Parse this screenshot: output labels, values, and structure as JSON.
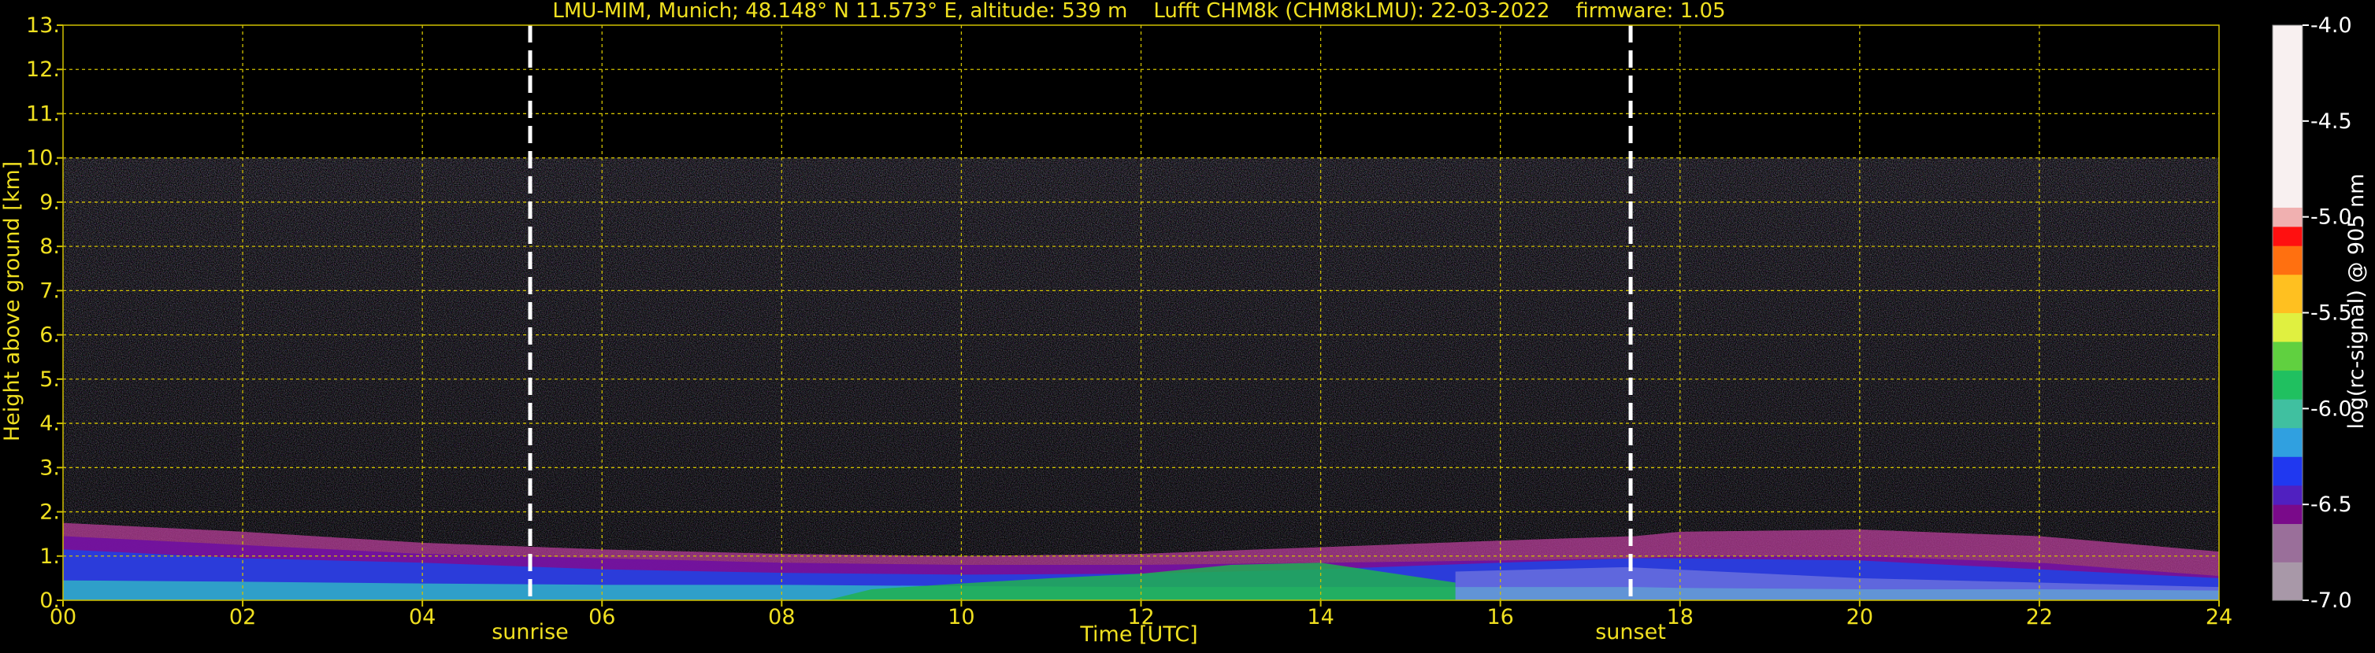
{
  "chart_data": {
    "type": "heatmap",
    "title": "LMU-MIM, Munich; 48.148° N 11.573° E, altitude: 539 m    Lufft CHM8k (CHM8kLMU): 22-03-2022    firmware: 1.05",
    "xlabel": "Time [UTC]",
    "ylabel": "Height above ground [km]",
    "xlim": [
      0,
      24
    ],
    "ylim": [
      0,
      13
    ],
    "x_ticks": [
      "00",
      "02",
      "04",
      "06",
      "08",
      "10",
      "12",
      "14",
      "16",
      "18",
      "20",
      "22",
      "24"
    ],
    "y_ticks": [
      "0.",
      "1.",
      "2.",
      "3.",
      "4.",
      "5.",
      "6.",
      "7.",
      "8.",
      "9.",
      "10.",
      "11.",
      "12.",
      "13."
    ],
    "grid": true,
    "data_max_height_km": 10,
    "markers": [
      {
        "label": "sunrise",
        "time_h": 5.2
      },
      {
        "label": "sunset",
        "time_h": 17.45
      }
    ],
    "layers": [
      {
        "name": "noise",
        "top_km": 10,
        "description_color": "speckle"
      },
      {
        "name": "pink-aerosol-top",
        "points": [
          [
            0,
            1.75
          ],
          [
            2,
            1.55
          ],
          [
            4,
            1.3
          ],
          [
            6,
            1.15
          ],
          [
            8,
            1.05
          ],
          [
            10,
            1.0
          ],
          [
            12,
            1.05
          ],
          [
            14,
            1.2
          ],
          [
            16,
            1.35
          ],
          [
            17.5,
            1.45
          ],
          [
            18,
            1.55
          ],
          [
            20,
            1.6
          ],
          [
            22,
            1.45
          ],
          [
            24,
            1.1
          ]
        ],
        "color": "#c040a0"
      },
      {
        "name": "purple-band",
        "points": [
          [
            0,
            1.45
          ],
          [
            2,
            1.25
          ],
          [
            4,
            1.05
          ],
          [
            6,
            0.95
          ],
          [
            8,
            0.85
          ],
          [
            10,
            0.8
          ],
          [
            12,
            0.8
          ],
          [
            14,
            0.85
          ],
          [
            16,
            0.9
          ],
          [
            17.5,
            0.95
          ],
          [
            18,
            1.0
          ],
          [
            20,
            1.0
          ],
          [
            22,
            0.85
          ],
          [
            24,
            0.55
          ]
        ],
        "color": "#7010a0"
      },
      {
        "name": "blue-mixing-layer",
        "points": [
          [
            0,
            1.15
          ],
          [
            2,
            0.95
          ],
          [
            4,
            0.85
          ],
          [
            6,
            0.7
          ],
          [
            8,
            0.62
          ],
          [
            10,
            0.58
          ],
          [
            12,
            0.6
          ],
          [
            14,
            0.7
          ],
          [
            16,
            0.85
          ],
          [
            17.5,
            0.95
          ],
          [
            18,
            0.95
          ],
          [
            20,
            0.9
          ],
          [
            22,
            0.7
          ],
          [
            24,
            0.5
          ]
        ],
        "color": "#2540e0"
      },
      {
        "name": "cyan-surface",
        "points": [
          [
            0,
            0.45
          ],
          [
            2,
            0.42
          ],
          [
            4,
            0.38
          ],
          [
            6,
            0.35
          ],
          [
            8,
            0.35
          ],
          [
            10,
            0.32
          ],
          [
            12,
            0.3
          ],
          [
            14,
            0.3
          ],
          [
            16,
            0.3
          ],
          [
            17.5,
            0.3
          ],
          [
            18,
            0.28
          ],
          [
            20,
            0.25
          ],
          [
            22,
            0.25
          ],
          [
            24,
            0.22
          ]
        ],
        "color": "#30a8c8"
      },
      {
        "name": "green-convective",
        "points": [
          [
            8.5,
            0
          ],
          [
            9,
            0.25
          ],
          [
            10,
            0.38
          ],
          [
            11,
            0.5
          ],
          [
            12,
            0.6
          ],
          [
            13,
            0.8
          ],
          [
            14,
            0.85
          ],
          [
            15,
            0.55
          ],
          [
            15.5,
            0.4
          ],
          [
            15.5,
            0
          ]
        ],
        "color": "#20b050"
      }
    ],
    "colorbar": {
      "label": "log(rc-signal) @ 905 nm",
      "vmin": -7.0,
      "vmax": -4.0,
      "ticks": [
        "-4.0",
        "-4.5",
        "-5.0",
        "-5.5",
        "-6.0",
        "-6.5",
        "-7.0"
      ],
      "stops": [
        {
          "v": -7.0,
          "c": "#a898a8"
        },
        {
          "v": -6.8,
          "c": "#9a6f9a"
        },
        {
          "v": -6.6,
          "c": "#7a0a8a"
        },
        {
          "v": -6.5,
          "c": "#5020c0"
        },
        {
          "v": -6.4,
          "c": "#2038f0"
        },
        {
          "v": -6.25,
          "c": "#30a0e0"
        },
        {
          "v": -6.1,
          "c": "#40c0a0"
        },
        {
          "v": -5.95,
          "c": "#20c060"
        },
        {
          "v": -5.8,
          "c": "#60d040"
        },
        {
          "v": -5.65,
          "c": "#e0f040"
        },
        {
          "v": -5.5,
          "c": "#ffc020"
        },
        {
          "v": -5.3,
          "c": "#ff7010"
        },
        {
          "v": -5.15,
          "c": "#ff1010"
        },
        {
          "v": -5.05,
          "c": "#f0b0b0"
        },
        {
          "v": -4.95,
          "c": "#f8f0f0"
        },
        {
          "v": -4.0,
          "c": "#ffffff"
        }
      ]
    },
    "colors": {
      "background": "#000000",
      "axis_text": "#f0e020",
      "grid": "#d0c000",
      "colorbar_text": "#ffffff",
      "marker": "#ffffff"
    }
  }
}
